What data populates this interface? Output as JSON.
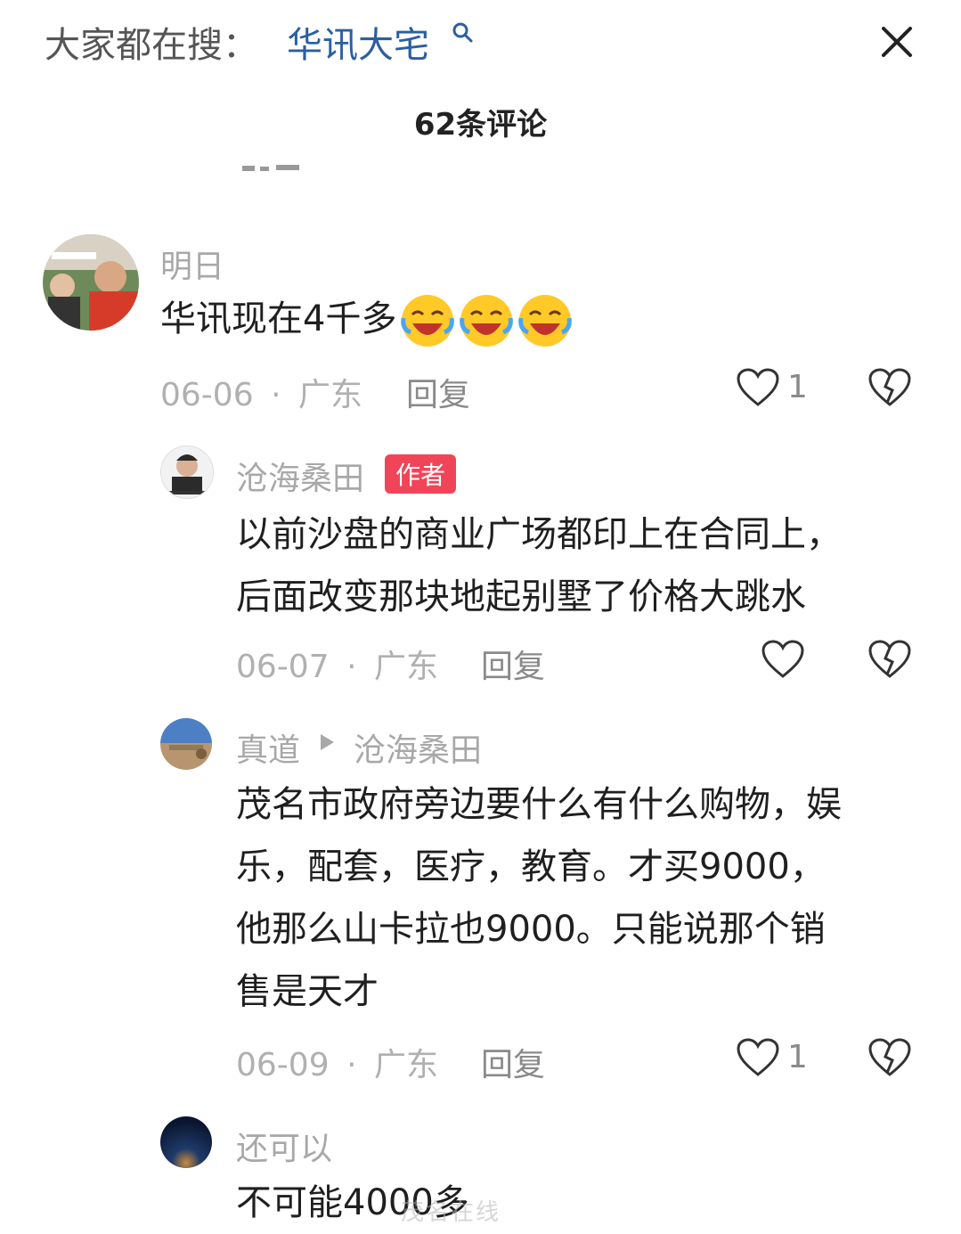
{
  "header": {
    "search_prefix": "大家都在搜：",
    "search_term": "华讯大宅",
    "comment_count": "62条评论"
  },
  "comments": [
    {
      "user": "明日",
      "text": "华讯现在4千多",
      "emojis": [
        "laughing-crying-emoji",
        "laughing-crying-emoji",
        "laughing-crying-emoji"
      ],
      "date": "06-06",
      "region": "广东",
      "reply_label": "回复",
      "likes": "1"
    },
    {
      "user": "沧海桑田",
      "badge": "作者",
      "text_lines": [
        "以前沙盘的商业广场都印上在合同上，",
        "后面改变那块地起别墅了价格大跳水"
      ],
      "date": "06-07",
      "region": "广东",
      "reply_label": "回复"
    },
    {
      "user": "真道",
      "reply_to": "沧海桑田",
      "text_lines": [
        "茂名市政府旁边要什么有什么购物，娱",
        "乐，配套，医疗，教育。才买9000，",
        "他那么山卡拉也9000。只能说那个销",
        "售是天才"
      ],
      "date": "06-09",
      "region": "广东",
      "reply_label": "回复",
      "likes": "1"
    },
    {
      "user": "还可以",
      "text": "不可能4000多"
    }
  ],
  "separator": "·",
  "watermark": "茂名在线"
}
